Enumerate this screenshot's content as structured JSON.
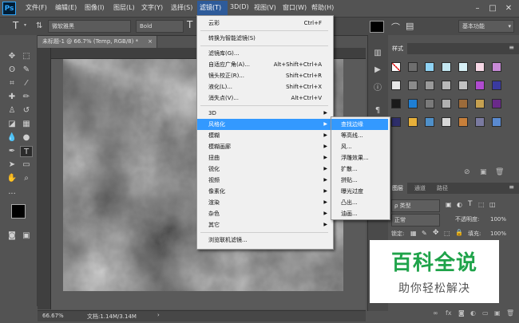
{
  "app": {
    "logo": "Ps"
  },
  "menubar": {
    "items": [
      "文件(F)",
      "编辑(E)",
      "图像(I)",
      "图层(L)",
      "文字(Y)",
      "选择(S)",
      "滤镜(T)",
      "3D(D)",
      "视图(V)",
      "窗口(W)",
      "帮助(H)"
    ],
    "active": "滤镜(T)",
    "window_buttons": [
      "minimize-icon",
      "maximize-icon",
      "close-icon"
    ]
  },
  "options_bar": {
    "tool_icon": "T",
    "font_family": "微软雅黑",
    "font_style": "Bold",
    "workspace": "基本功能"
  },
  "document": {
    "tab_title": "未标题-1 @ 66.7% (Temp, RGB/8) *",
    "zoom": "66.67%",
    "doc_info": "文档:1.14M/3.14M"
  },
  "filter_menu": {
    "items": [
      {
        "label": "云彩",
        "shortcut": "Ctrl+F"
      },
      {
        "sep": true
      },
      {
        "label": "转换为智能滤镜(S)"
      },
      {
        "sep": true
      },
      {
        "label": "滤镜库(G)..."
      },
      {
        "label": "自适应广角(A)...",
        "shortcut": "Alt+Shift+Ctrl+A"
      },
      {
        "label": "镜头校正(R)...",
        "shortcut": "Shift+Ctrl+R"
      },
      {
        "label": "液化(L)...",
        "shortcut": "Shift+Ctrl+X"
      },
      {
        "label": "消失点(V)...",
        "shortcut": "Alt+Ctrl+V"
      },
      {
        "sep": true
      },
      {
        "label": "3D",
        "submenu": true
      },
      {
        "label": "风格化",
        "submenu": true,
        "highlight": true
      },
      {
        "label": "模糊",
        "submenu": true
      },
      {
        "label": "模糊画廊",
        "submenu": true
      },
      {
        "label": "扭曲",
        "submenu": true
      },
      {
        "label": "锐化",
        "submenu": true
      },
      {
        "label": "视频",
        "submenu": true
      },
      {
        "label": "像素化",
        "submenu": true
      },
      {
        "label": "渲染",
        "submenu": true
      },
      {
        "label": "杂色",
        "submenu": true
      },
      {
        "label": "其它",
        "submenu": true
      },
      {
        "sep": true
      },
      {
        "label": "浏览联机滤镜..."
      }
    ]
  },
  "stylize_submenu": {
    "items": [
      "查找边缘",
      "等高线...",
      "风...",
      "浮雕效果...",
      "扩散...",
      "拼贴...",
      "曝光过度",
      "凸出...",
      "油画..."
    ],
    "highlight": "查找边缘"
  },
  "styles_panel": {
    "tab": "样式",
    "colors": [
      "#f4f4f4",
      "#6e6e6e",
      "#8fd3f4",
      "#c3e6f0",
      "#d8f1f7",
      "#f7d8e6",
      "#c98bd8",
      "#e8e8e8",
      "#8b8b8b",
      "#9a9a9a",
      "#b9b9b9",
      "#c2c2c2",
      "#b04bd0",
      "#3a3aa0",
      "#1a1a1a",
      "#1f7fd4",
      "#7a7a7a",
      "#b0b0b0",
      "#9c6b3a",
      "#c5a050",
      "#6a2a8a",
      "#2d2d6a",
      "#e7b03a",
      "#4f90c9",
      "#d8d8d8",
      "#c77f3a",
      "#7a7aa0",
      "#5a8ad0"
    ]
  },
  "layers_panel": {
    "tabs": [
      "图层",
      "通道",
      "路径"
    ],
    "filter_label": "ρ 类型",
    "blend_mode": "正常",
    "opacity_label": "不透明度:",
    "opacity_value": "100%",
    "lock_label": "锁定:",
    "fill_label": "填充:",
    "fill_value": "100%"
  },
  "watermark": {
    "big": "百科全说",
    "small": "助你轻松解决"
  }
}
